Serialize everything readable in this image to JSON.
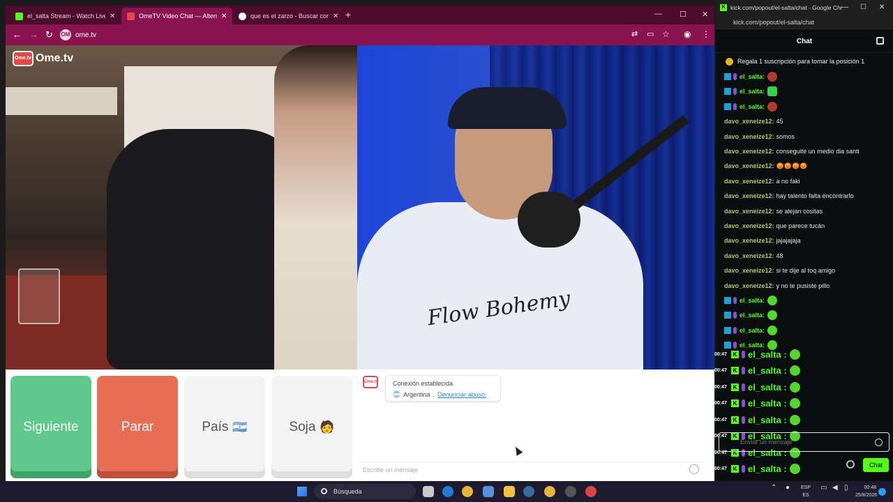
{
  "browser": {
    "tabs": [
      {
        "label": "el_salta Stream - Watch Live on Kick",
        "active": false,
        "icon": "kick-favicon"
      },
      {
        "label": "OmeTV Video Chat — Alternative",
        "active": true,
        "icon": "ometv-favicon"
      },
      {
        "label": "que es el zarzo - Buscar con Google",
        "active": false,
        "icon": "google-favicon"
      }
    ],
    "new_tab": "+",
    "url": "ome.tv",
    "site_icon_text": "OM"
  },
  "ometv": {
    "logo_text": "Ome.tv",
    "logo_icon_text": "Ome.tv",
    "buttons": {
      "next": "Siguiente",
      "stop": "Parar",
      "country": "País",
      "country_emoji": "🇦🇷",
      "gender": "Soja",
      "gender_emoji": "🧑"
    },
    "system_msg": {
      "title": "Conexión establecida",
      "country": "Argentina",
      "separator": ".",
      "report_link": "Denunciar abuso."
    },
    "message_placeholder": "Escribe un mensaje",
    "shirt_text": "Flow Bohemy"
  },
  "kick": {
    "window_title": "kick.com/popout/el-salta/chat - Google Chrome",
    "url": "kick.com/popout/el-salta/chat",
    "header": "Chat",
    "pinned": "Regala 1 suscripción para tomar la posición 1",
    "messages": [
      {
        "user": "el_salta:",
        "type": "el",
        "emote": "red"
      },
      {
        "user": "el_salta:",
        "type": "el",
        "emote": "face"
      },
      {
        "user": "el_salta:",
        "type": "el",
        "emote": "red"
      },
      {
        "user": "davo_xeneize12:",
        "type": "davo",
        "text": "45"
      },
      {
        "user": "davo_xeneize12:",
        "type": "davo",
        "text": "somos"
      },
      {
        "user": "davo_xeneize12:",
        "type": "davo",
        "text": "conseguite un medio dia santi"
      },
      {
        "user": "davo_xeneize12:",
        "type": "davo",
        "text": "😡😡😡😡"
      },
      {
        "user": "davo_xeneize12:",
        "type": "davo",
        "text": "a no faki"
      },
      {
        "user": "davo_xeneize12:",
        "type": "davo",
        "text": "hay talento falta encontrarlo"
      },
      {
        "user": "davo_xeneize12:",
        "type": "davo",
        "text": "se alejan cositas"
      },
      {
        "user": "davo_xeneize12:",
        "type": "davo",
        "text": "que parece tucán"
      },
      {
        "user": "davo_xeneize12:",
        "type": "davo",
        "text": "jajajajaja"
      },
      {
        "user": "davo_xeneize12:",
        "type": "davo",
        "text": "48"
      },
      {
        "user": "davo_xeneize12:",
        "type": "davo",
        "text": "si te dije al toq amigo"
      },
      {
        "user": "davo_xeneize12:",
        "type": "davo",
        "text": "y no te pusiste pillo"
      },
      {
        "user": "el_salta:",
        "type": "el",
        "emote": "green"
      },
      {
        "user": "el_salta:",
        "type": "el",
        "emote": "green"
      },
      {
        "user": "el_salta:",
        "type": "el",
        "emote": "green"
      },
      {
        "user": "el_salta:",
        "type": "el",
        "emote": "green"
      }
    ],
    "overlay": {
      "time": "00:47",
      "name": "el_salta :",
      "rows": 8
    },
    "send_placeholder": "Enviar un mensaje",
    "chat_button": "Chat"
  },
  "taskbar": {
    "search": "Búsqueda",
    "lang_top": "ESP",
    "lang_bottom": "ES",
    "time": "00:48",
    "date": "25/8/2026"
  },
  "colors": {
    "chrome_tabstrip": "#4d0b2e",
    "chrome_toolbar": "#8a1450",
    "kick_green": "#53fc18",
    "ometv_next": "#5ec98a",
    "ometv_stop": "#e76d55"
  }
}
